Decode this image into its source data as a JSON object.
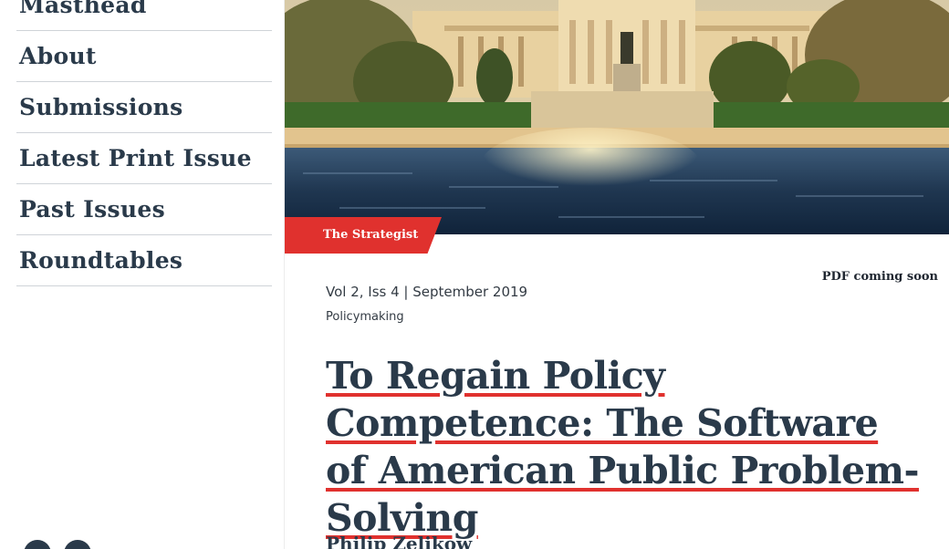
{
  "sidebar": {
    "items": [
      {
        "label": "Masthead"
      },
      {
        "label": "About"
      },
      {
        "label": "Submissions"
      },
      {
        "label": "Latest Print Issue"
      },
      {
        "label": "Past Issues"
      },
      {
        "label": "Roundtables"
      }
    ]
  },
  "hero": {
    "image_description_icon": "capitol-building-photo",
    "section_tag": "The Strategist"
  },
  "article": {
    "pdf_note": "PDF coming soon",
    "meta": "Vol 2, Iss 4 | September 2019",
    "category": "Policymaking",
    "title": "To Regain Policy Competence: The Software of American Public Problem-Solving",
    "author": "Philip Zelikow"
  },
  "colors": {
    "accent": "#e0312e",
    "text": "#2a3a4a"
  }
}
